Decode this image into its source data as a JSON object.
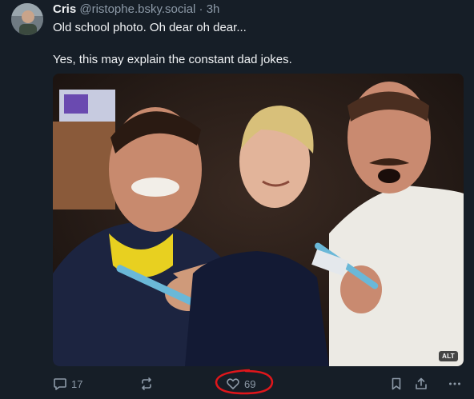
{
  "author": {
    "name": "Cris",
    "handle": "@ristophe.bsky.social",
    "separator": "·",
    "time": "3h"
  },
  "post": {
    "lines": [
      "Old school photo. Oh dear oh dear...",
      "Yes, this may explain the constant dad jokes."
    ],
    "image": {
      "alt_badge": "ALT"
    }
  },
  "actions": {
    "reply_icon": "reply-icon",
    "reply_count": "17",
    "repost_icon": "repost-icon",
    "like_icon": "heart-icon",
    "like_count": "69",
    "bookmark_icon": "bookmark-icon",
    "share_icon": "share-icon",
    "more_icon": "more-icon"
  },
  "colors": {
    "background": "#161e27",
    "muted_text": "#8d9aa8",
    "annotation": "#e0161b"
  }
}
